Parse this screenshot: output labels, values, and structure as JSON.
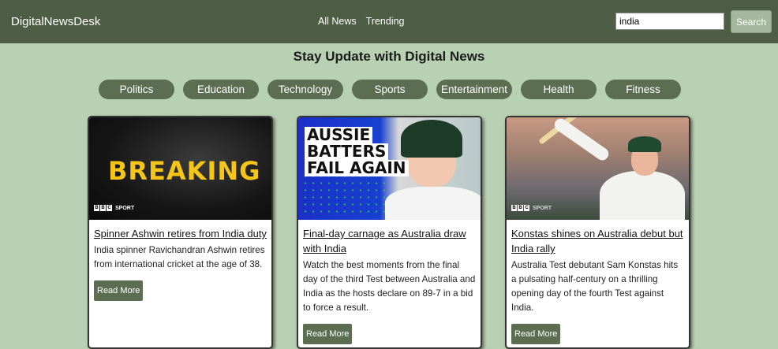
{
  "navbar": {
    "brand": "DigitalNewsDesk",
    "links": [
      "All News",
      "Trending"
    ],
    "search_value": "india",
    "search_button": "Search"
  },
  "headline": "Stay Update with Digital News",
  "categories": [
    "Politics",
    "Education",
    "Technology",
    "Sports",
    "Entertainment",
    "Health",
    "Fitness"
  ],
  "articles": [
    {
      "image_text": "BREAKING",
      "image_source": "SPORT",
      "title": "Spinner Ashwin retires from India duty",
      "description": "India spinner Ravichandran Ashwin retires from international cricket at the age of 38.",
      "read_more": "Read More"
    },
    {
      "image_text": [
        "AUSSIE",
        "BATTERS",
        "FAIL AGAIN"
      ],
      "title": "Final-day carnage as Australia draw with India",
      "description": "Watch the best moments from the final day of the third Test between Australia and India as the hosts declare on 89-7 in a bid to force a result.",
      "read_more": "Read More"
    },
    {
      "image_source": "SPORT",
      "title": "Konstas shines on Australia debut but India rally",
      "description": "Australia Test debutant Sam Konstas hits a pulsating half-century on a thrilling opening day of the fourth Test against India.",
      "read_more": "Read More"
    }
  ],
  "colors": {
    "background": "#b9d1b3",
    "navbar": "#4e5d45",
    "pill": "#5b6e52",
    "search_button": "#a4b89d"
  }
}
